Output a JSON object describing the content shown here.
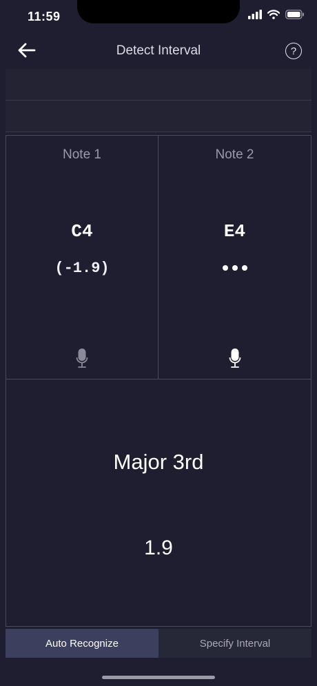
{
  "status_bar": {
    "time": "11:59"
  },
  "nav": {
    "title": "Detect Interval"
  },
  "notes": [
    {
      "label": "Note 1",
      "name": "C4",
      "cents": "(-1.9)",
      "mic_state": "inactive",
      "mic_color": "#8a8a9a"
    },
    {
      "label": "Note 2",
      "name": "E4",
      "cents_pending": true,
      "mic_state": "active",
      "mic_color": "#ffffff"
    }
  ],
  "result": {
    "interval": "Major 3rd",
    "value": "1.9"
  },
  "tabs": [
    {
      "label": "Auto Recognize",
      "selected": true
    },
    {
      "label": "Specify Interval",
      "selected": false
    }
  ],
  "colors": {
    "background": "#1f1e30",
    "active_tab": "#3c3f5e",
    "inactive_tab": "#262838",
    "divider": "#4a4a5e"
  }
}
